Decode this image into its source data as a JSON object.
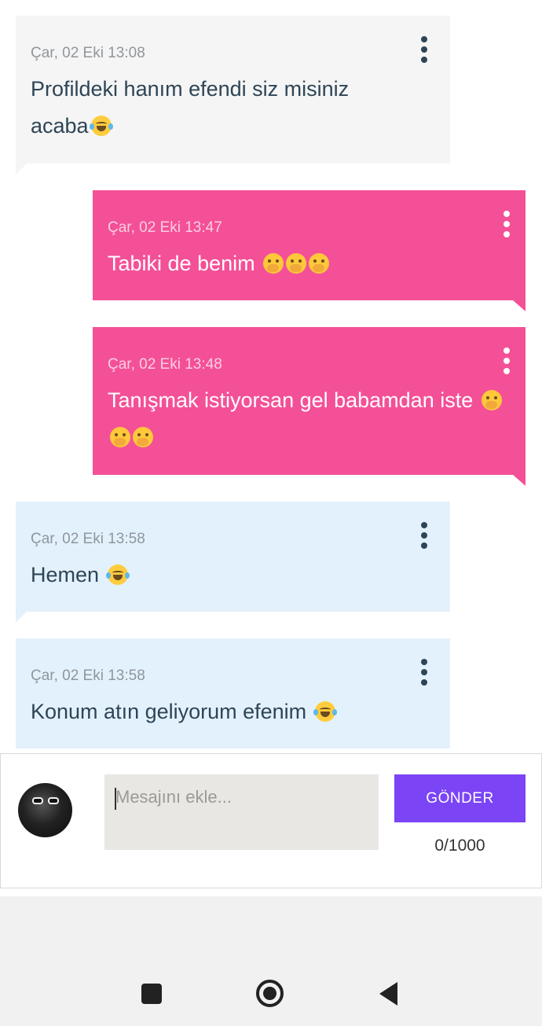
{
  "messages": [
    {
      "id": "m1",
      "direction": "incoming",
      "timestamp": "Çar, 02 Eki 13:08",
      "text": "Profildeki hanım efendi siz misiniz acaba",
      "emojis": [
        "laughing-with-tears"
      ],
      "bg": "#f5f5f5"
    },
    {
      "id": "m2",
      "direction": "outgoing",
      "timestamp": "Çar, 02 Eki 13:47",
      "text": "Tabiki de benim",
      "emojis": [
        "hand-over-mouth",
        "hand-over-mouth",
        "hand-over-mouth"
      ],
      "bg": "#f45097"
    },
    {
      "id": "m3",
      "direction": "outgoing",
      "timestamp": "Çar, 02 Eki 13:48",
      "text": "Tanışmak istiyorsan gel babamdan iste",
      "emojis": [
        "hand-over-mouth",
        "hand-over-mouth",
        "hand-over-mouth"
      ],
      "bg": "#f45097"
    },
    {
      "id": "m4",
      "direction": "incoming",
      "timestamp": "Çar, 02 Eki 13:58",
      "text": "Hemen",
      "emojis": [
        "laughing-with-tears"
      ],
      "bg": "#e3f1fd"
    },
    {
      "id": "m5",
      "direction": "incoming",
      "timestamp": "Çar, 02 Eki 13:58",
      "text": "Konum atın geliyorum efenim",
      "emojis": [
        "laughing-with-tears"
      ],
      "bg": "#e3f1fd"
    }
  ],
  "composer": {
    "placeholder": "Mesajını ekle...",
    "value": "",
    "send_label": "GÖNDER",
    "counter": "0/1000",
    "send_color": "#7b44f5"
  },
  "navbar": {
    "icons": [
      "recent-apps-icon",
      "home-icon",
      "back-icon"
    ]
  }
}
